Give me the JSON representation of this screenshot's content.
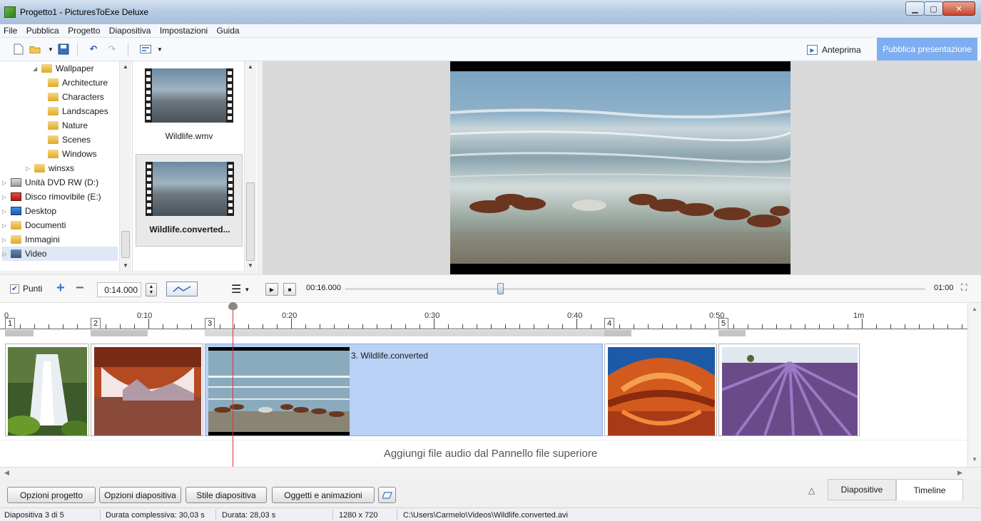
{
  "window": {
    "title": "Progetto1 - PicturesToExe Deluxe"
  },
  "menu": [
    "File",
    "Pubblica",
    "Progetto",
    "Diapositiva",
    "Impostazioni",
    "Guida"
  ],
  "toolbar": {
    "preview_label": "Anteprima",
    "publish_label": "Pubblica presentazione"
  },
  "tree": {
    "items": [
      {
        "label": "Wallpaper",
        "level": 4,
        "icon": "folder-icon",
        "arrow": "expanded"
      },
      {
        "label": "Architecture",
        "level": 5,
        "icon": "folder-icon"
      },
      {
        "label": "Characters",
        "level": 5,
        "icon": "folder-icon"
      },
      {
        "label": "Landscapes",
        "level": 5,
        "icon": "folder-icon"
      },
      {
        "label": "Nature",
        "level": 5,
        "icon": "folder-icon"
      },
      {
        "label": "Scenes",
        "level": 5,
        "icon": "folder-icon"
      },
      {
        "label": "Windows",
        "level": 5,
        "icon": "folder-icon"
      },
      {
        "label": "winsxs",
        "level": 3,
        "icon": "folder-icon",
        "arrow": "collapsed"
      },
      {
        "label": "Unità DVD RW (D:)",
        "level": 1,
        "icon": "dvd-drive-icon",
        "arrow": "collapsed"
      },
      {
        "label": "Disco rimovibile (E:)",
        "level": 1,
        "icon": "removable-disk-icon",
        "arrow": "collapsed"
      },
      {
        "label": "Desktop",
        "level": 1,
        "icon": "desktop-icon",
        "arrow": "collapsed"
      },
      {
        "label": "Documenti",
        "level": 1,
        "icon": "documents-icon",
        "arrow": "collapsed"
      },
      {
        "label": "Immagini",
        "level": 1,
        "icon": "pictures-icon",
        "arrow": "collapsed"
      },
      {
        "label": "Video",
        "level": 1,
        "icon": "video-folder-icon",
        "arrow": "collapsed",
        "selected": true
      }
    ]
  },
  "files": [
    {
      "name": "Wildlife.wmv",
      "selected": false
    },
    {
      "name": "Wildlife.converted...",
      "selected": true
    }
  ],
  "controls": {
    "points_label": "Punti",
    "points_checked": true,
    "time_value": "0:14.000",
    "playback_time": "00:16.000",
    "end_time": "01:00",
    "slider_fraction": 0.27
  },
  "ruler": {
    "labels": [
      "0",
      "0:10",
      "0:20",
      "0:30",
      "0:40",
      "0:50",
      "1m"
    ],
    "markers": [
      "1",
      "2",
      "3",
      "4",
      "5"
    ]
  },
  "slides": [
    {
      "index": 1,
      "title": "",
      "theme": "waterfall"
    },
    {
      "index": 2,
      "title": "",
      "theme": "arch"
    },
    {
      "index": 3,
      "title": "3. Wildlife.converted",
      "theme": "horses",
      "active": true
    },
    {
      "index": 4,
      "title": "",
      "theme": "canyon"
    },
    {
      "index": 5,
      "title": "",
      "theme": "lavender"
    }
  ],
  "audio_hint": "Aggiungi file audio dal Pannello file superiore",
  "buttons": {
    "project_options": "Opzioni progetto",
    "slide_options": "Opzioni diapositiva",
    "slide_style": "Stile diapositiva",
    "objects_animations": "Oggetti e animazioni"
  },
  "tabs": {
    "slides": "Diapositive",
    "timeline": "Timeline",
    "active": "Timeline"
  },
  "status": {
    "slide": "Diapositiva 3 di 5",
    "total_duration": "Durata complessiva: 30,03 s",
    "duration": "Durata: 28,03 s",
    "resolution": "1280 x 720",
    "path": "C:\\Users\\Carmelo\\Videos\\Wildlife.converted.avi"
  }
}
